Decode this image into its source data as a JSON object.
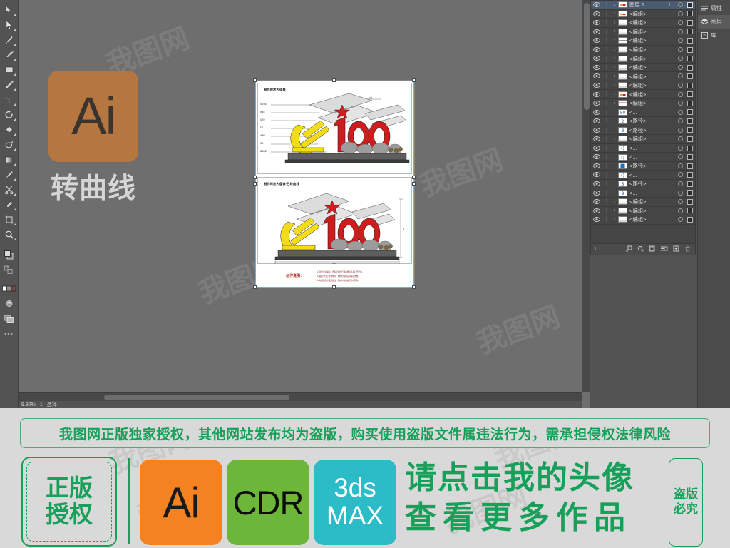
{
  "app": {
    "name": "Adobe Illustrator",
    "toolbar": {
      "tools": [
        {
          "name": "selection-tool",
          "glyph": "▶"
        },
        {
          "name": "direct-selection-tool",
          "glyph": "▷"
        },
        {
          "name": "pen-tool",
          "glyph": "pen"
        },
        {
          "name": "curvature-tool",
          "glyph": "curvature"
        },
        {
          "name": "rectangle-tool",
          "glyph": "rect"
        },
        {
          "name": "line-segment-tool",
          "glyph": "line"
        },
        {
          "name": "type-tool",
          "glyph": "T"
        },
        {
          "name": "rotate-tool",
          "glyph": "rotate"
        },
        {
          "name": "shape-builder-tool",
          "glyph": "shape"
        },
        {
          "name": "gradient-mesh-tool",
          "glyph": "mesh"
        },
        {
          "name": "gradient-tool",
          "glyph": "gradient"
        },
        {
          "name": "paintbrush-tool",
          "glyph": "brush"
        },
        {
          "name": "scissors-tool",
          "glyph": "scissors"
        },
        {
          "name": "eyedropper-tool",
          "glyph": "eyedropper"
        },
        {
          "name": "artboard-tool",
          "glyph": "artboard"
        },
        {
          "name": "zoom-tool",
          "glyph": "zoom"
        },
        {
          "name": "fill-stroke-swatches",
          "glyph": "fillstroke"
        },
        {
          "name": "question-tool",
          "glyph": "?"
        },
        {
          "name": "screen-mode-tool",
          "glyph": "screen"
        },
        {
          "name": "color-mode-swatch",
          "glyph": "colorbar"
        },
        {
          "name": "drawing-mode-tool",
          "glyph": "drawmode"
        },
        {
          "name": "more-tools",
          "glyph": "..."
        }
      ]
    },
    "statusbar": {
      "zoom": "9.32%",
      "artboard_nav": "1",
      "tool_status": "选择"
    },
    "document": {
      "artboard": {
        "panels": [
          {
            "title": "制作时放大值像",
            "callouts": [
              "铝合金面",
              "钟板面",
              "反光膜",
              "钉字",
              "不锈钢",
              "基座",
              "碳钢骨架"
            ]
          },
          {
            "title": "制作时放大值像-已转曲线",
            "dim_width": "5000",
            "dim_height": "高"
          }
        ],
        "note": {
          "label": "创作说明：",
          "lines": [
            "1. 源文件可编辑，所有字体均已转曲线可直接打开使用。",
            "2. 图片中尺寸仅作参考，制作时根据实际情况调整。",
            "3. 材质颜色可按需更改，图中内容版权归作者所有。"
          ]
        }
      }
    },
    "layers_panel": {
      "tab_layers": "图层",
      "tab_library": "库",
      "rows": [
        {
          "name": "图层 1",
          "index": "1",
          "selected": true,
          "expandable": true,
          "depth": 0,
          "thumb": "art"
        },
        {
          "name": "<编组>",
          "selected": false,
          "expandable": true,
          "depth": 1,
          "thumb": "art"
        },
        {
          "name": "<编组>",
          "selected": false,
          "expandable": true,
          "depth": 1,
          "thumb": "blank"
        },
        {
          "name": "<编组>",
          "selected": false,
          "expandable": true,
          "depth": 1,
          "thumb": "blank"
        },
        {
          "name": "<编组>",
          "selected": false,
          "expandable": true,
          "depth": 1,
          "thumb": "line"
        },
        {
          "name": "<编组>",
          "selected": false,
          "expandable": true,
          "depth": 1,
          "thumb": "blank"
        },
        {
          "name": "<编组>",
          "selected": false,
          "expandable": true,
          "depth": 1,
          "thumb": "blank"
        },
        {
          "name": "<编组>",
          "selected": false,
          "expandable": true,
          "depth": 1,
          "thumb": "blank"
        },
        {
          "name": "<编组>",
          "selected": false,
          "expandable": true,
          "depth": 1,
          "thumb": "blank"
        },
        {
          "name": "<编组>",
          "selected": false,
          "expandable": true,
          "depth": 1,
          "thumb": "blank"
        },
        {
          "name": "<编组>",
          "selected": false,
          "expandable": true,
          "depth": 1,
          "thumb": "art"
        },
        {
          "name": "<编组>",
          "selected": false,
          "expandable": true,
          "depth": 1,
          "thumb": "redline"
        },
        {
          "name": "<...",
          "selected": false,
          "expandable": false,
          "depth": 1,
          "thumb": "glyph88"
        },
        {
          "name": "<路径>",
          "selected": false,
          "expandable": false,
          "depth": 1,
          "thumb": "glyph2"
        },
        {
          "name": "<路径>",
          "selected": false,
          "expandable": false,
          "depth": 1,
          "thumb": "glyph3"
        },
        {
          "name": "<编组>",
          "selected": false,
          "expandable": true,
          "depth": 1,
          "thumb": "blank"
        },
        {
          "name": "<...",
          "selected": false,
          "expandable": false,
          "depth": 1,
          "thumb": "glyph0"
        },
        {
          "name": "<...",
          "selected": false,
          "expandable": false,
          "depth": 1,
          "thumb": "glyph0"
        },
        {
          "name": "<路径>",
          "selected": false,
          "expandable": false,
          "depth": 1,
          "thumb": "glyphfill"
        },
        {
          "name": "<...",
          "selected": false,
          "expandable": false,
          "depth": 1,
          "thumb": "glyph0"
        },
        {
          "name": "<路径>",
          "selected": false,
          "expandable": false,
          "depth": 1,
          "thumb": "glyph5"
        },
        {
          "name": "<...",
          "selected": false,
          "expandable": false,
          "depth": 1,
          "thumb": "glyph9"
        },
        {
          "name": "<编组>",
          "selected": false,
          "expandable": true,
          "depth": 1,
          "thumb": "blank"
        },
        {
          "name": "<编组>",
          "selected": false,
          "expandable": true,
          "depth": 1,
          "thumb": "blank"
        },
        {
          "name": "<编组>",
          "selected": false,
          "expandable": true,
          "depth": 1,
          "thumb": "blank"
        }
      ],
      "footer": {
        "count": "1...",
        "buttons": [
          "locate-object",
          "search-layer",
          "make-clipping-mask",
          "create-sublayer",
          "new-layer",
          "delete-layer"
        ]
      }
    }
  },
  "overlay": {
    "ai_badge_letters": "Ai",
    "ai_badge_caption": "转曲线",
    "ai_badge_color": "#b5763f"
  },
  "promo": {
    "notice": "我图网正版独家授权，其他网站发布均为盗版，购买使用盗版文件属违法行为，需承担侵权法律风险",
    "notice_color": "#17a05a",
    "licence_badge": {
      "line1": "正版",
      "line2": "授权"
    },
    "format_badges": [
      {
        "label": "Ai",
        "color": "#f58220",
        "text_color": "#1a1a1a",
        "name": "ai"
      },
      {
        "label": "CDR",
        "color": "#6cb63a",
        "text_color": "#0d0d0d",
        "name": "cdr"
      },
      {
        "label": "3ds MAX",
        "line1": "3ds",
        "line2": "MAX",
        "color": "#2bbcc8",
        "text_color": "#ffffff",
        "name": "max"
      }
    ],
    "cta_line1": "请点击我的头像",
    "cta_line2": "查看更多作品",
    "side_stamp": "盗版必究"
  }
}
